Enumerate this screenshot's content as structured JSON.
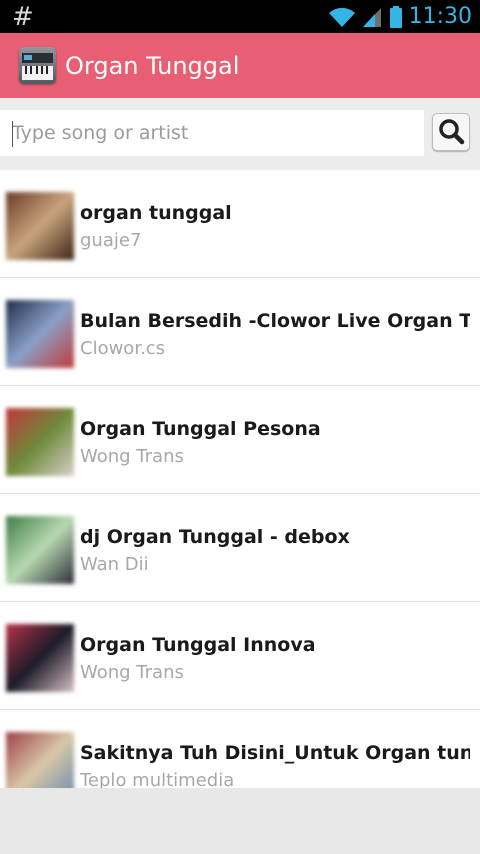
{
  "status_bar": {
    "left_symbol": "#",
    "time": "11:30"
  },
  "app_bar": {
    "title": "Organ Tunggal",
    "color": "#e85f73"
  },
  "search": {
    "placeholder": "Type song or artist",
    "value": ""
  },
  "songs": [
    {
      "title": "organ tunggal",
      "artist": "guaje7",
      "thumb_colors": [
        "#6b3a2a",
        "#c9a47c",
        "#3d2618"
      ]
    },
    {
      "title": "Bulan Bersedih -Clowor Live Organ T...",
      "artist": "Clowor.cs",
      "thumb_colors": [
        "#1f2d4a",
        "#8aa0c8",
        "#c13b3b"
      ]
    },
    {
      "title": "Organ Tunggal Pesona",
      "artist": "Wong Trans",
      "thumb_colors": [
        "#c2363b",
        "#6e8a3a",
        "#d9d0c8"
      ]
    },
    {
      "title": "dj Organ Tunggal - debox",
      "artist": "Wan Dii",
      "thumb_colors": [
        "#3e7d47",
        "#b7d9b0",
        "#2c2c3a"
      ]
    },
    {
      "title": "Organ Tunggal Innova",
      "artist": "Wong Trans",
      "thumb_colors": [
        "#b8324a",
        "#1c1c28",
        "#d8c0c8"
      ]
    },
    {
      "title": "Sakitnya Tuh Disini_Untuk Organ tun...",
      "artist": "Teplo multimedia",
      "thumb_colors": [
        "#9f3f4a",
        "#d9c7a6",
        "#6a8ab1"
      ]
    }
  ]
}
